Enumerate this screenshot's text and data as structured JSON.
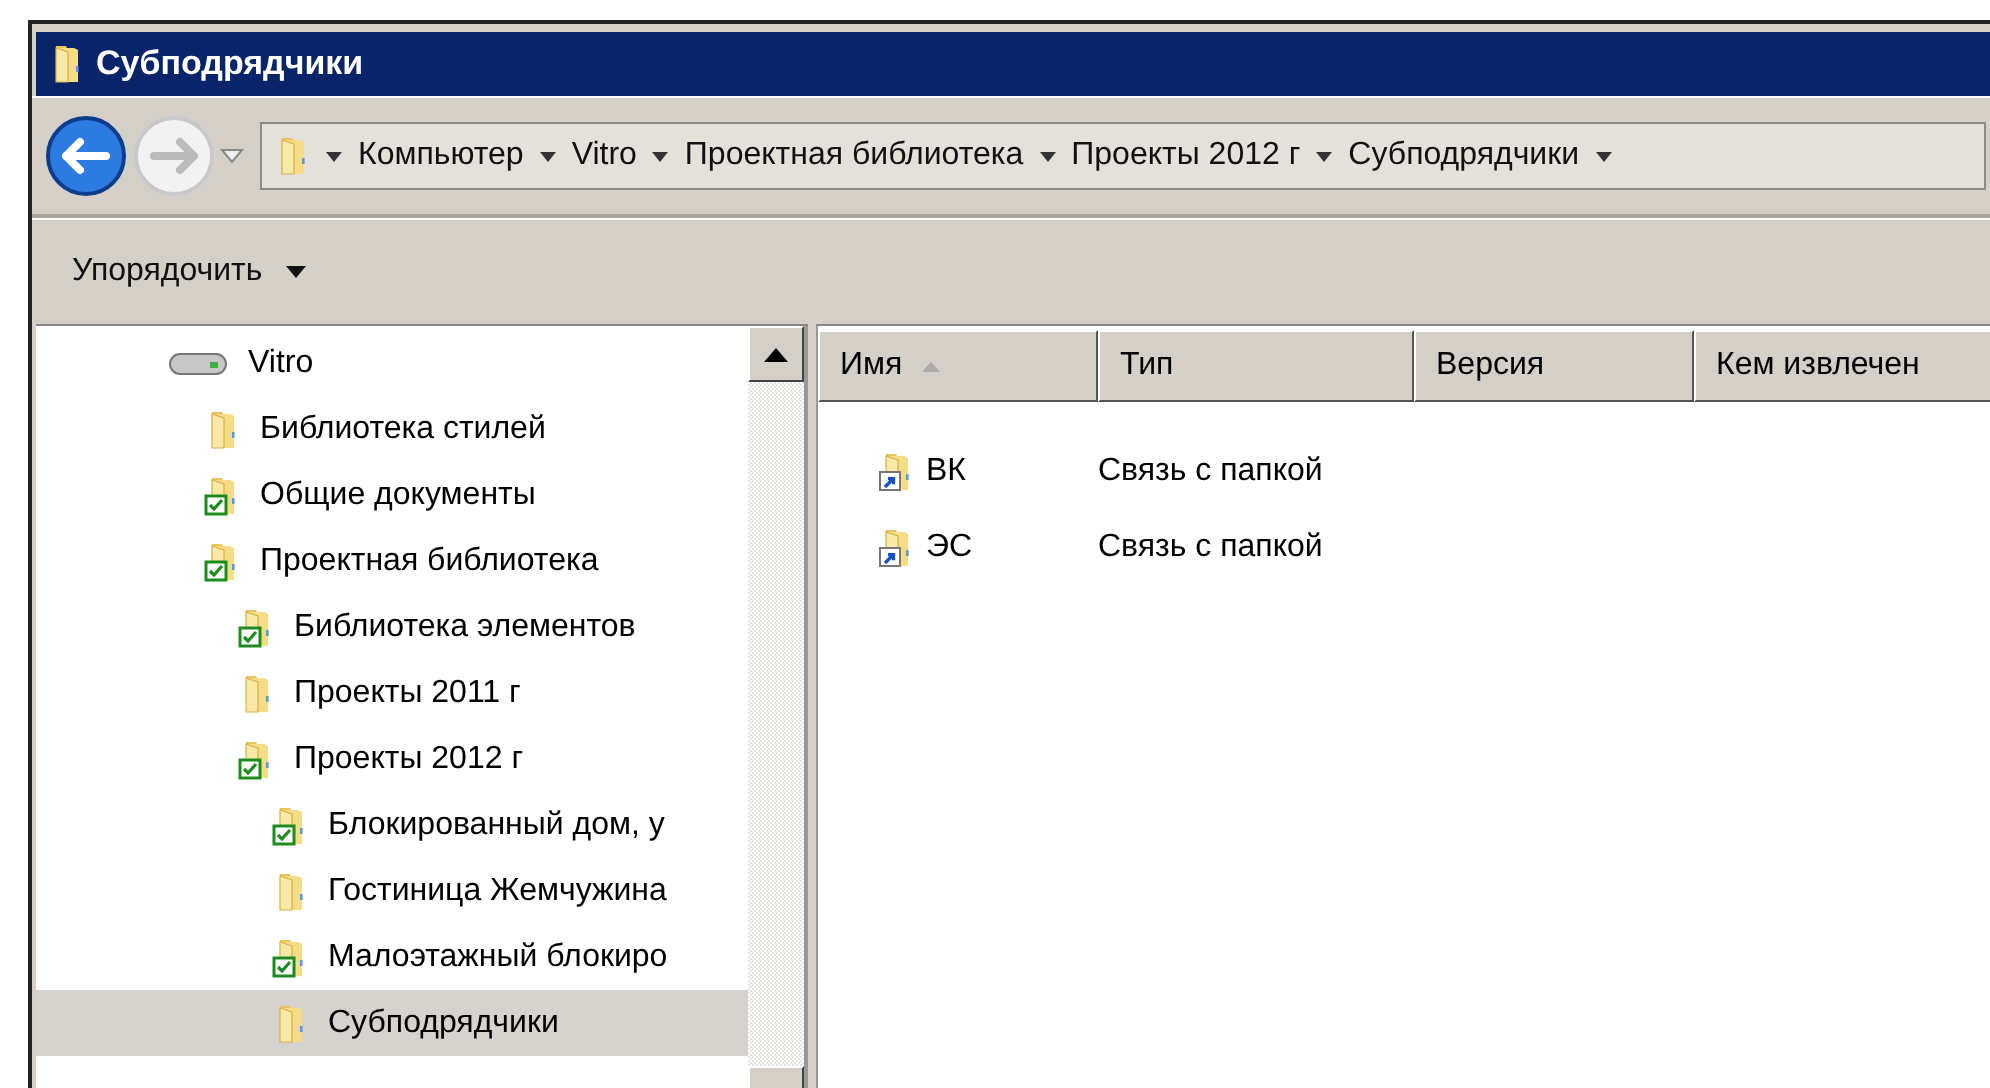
{
  "window": {
    "title": "Субподрядчики"
  },
  "navigation": {
    "back": {
      "disabled": false
    },
    "forward": {
      "disabled": true
    }
  },
  "address_bar": {
    "breadcrumbs": [
      "Компьютер",
      "Vitro",
      "Проектная библиотека",
      "Проекты 2012 г",
      "Субподрядчики"
    ]
  },
  "toolbar": {
    "organize": "Упорядочить"
  },
  "tree": [
    {
      "label": "Vitro",
      "kind": "drive",
      "selected": false,
      "children": [
        {
          "label": "Библиотека стилей",
          "kind": "folder",
          "synced": false,
          "selected": false
        },
        {
          "label": "Общие документы",
          "kind": "folder",
          "synced": true,
          "selected": false
        },
        {
          "label": "Проектная библиотека",
          "kind": "folder",
          "synced": true,
          "selected": false,
          "children": [
            {
              "label": "Библиотека элементов",
              "kind": "folder",
              "synced": true,
              "selected": false
            },
            {
              "label": "Проекты 2011 г",
              "kind": "folder",
              "synced": false,
              "selected": false
            },
            {
              "label": "Проекты 2012 г",
              "kind": "folder",
              "synced": true,
              "selected": false,
              "children": [
                {
                  "label": "Блокированный дом, у",
                  "kind": "folder",
                  "synced": true,
                  "selected": false
                },
                {
                  "label": "Гостиница Жемчужина",
                  "kind": "folder",
                  "synced": false,
                  "selected": false
                },
                {
                  "label": "Малоэтажный блокиро",
                  "kind": "folder",
                  "synced": true,
                  "selected": false
                },
                {
                  "label": "Субподрядчики",
                  "kind": "folder",
                  "synced": false,
                  "selected": true
                }
              ]
            }
          ]
        }
      ]
    }
  ],
  "file_list": {
    "columns": [
      {
        "label": "Имя",
        "sorted": true
      },
      {
        "label": "Тип",
        "sorted": false
      },
      {
        "label": "Версия",
        "sorted": false
      },
      {
        "label": "Кем извлечен",
        "sorted": false
      }
    ],
    "rows": [
      {
        "name": "ВК",
        "type": "Связь с папкой",
        "kind": "folder-link"
      },
      {
        "name": "ЭС",
        "type": "Связь с папкой",
        "kind": "folder-link"
      }
    ]
  }
}
